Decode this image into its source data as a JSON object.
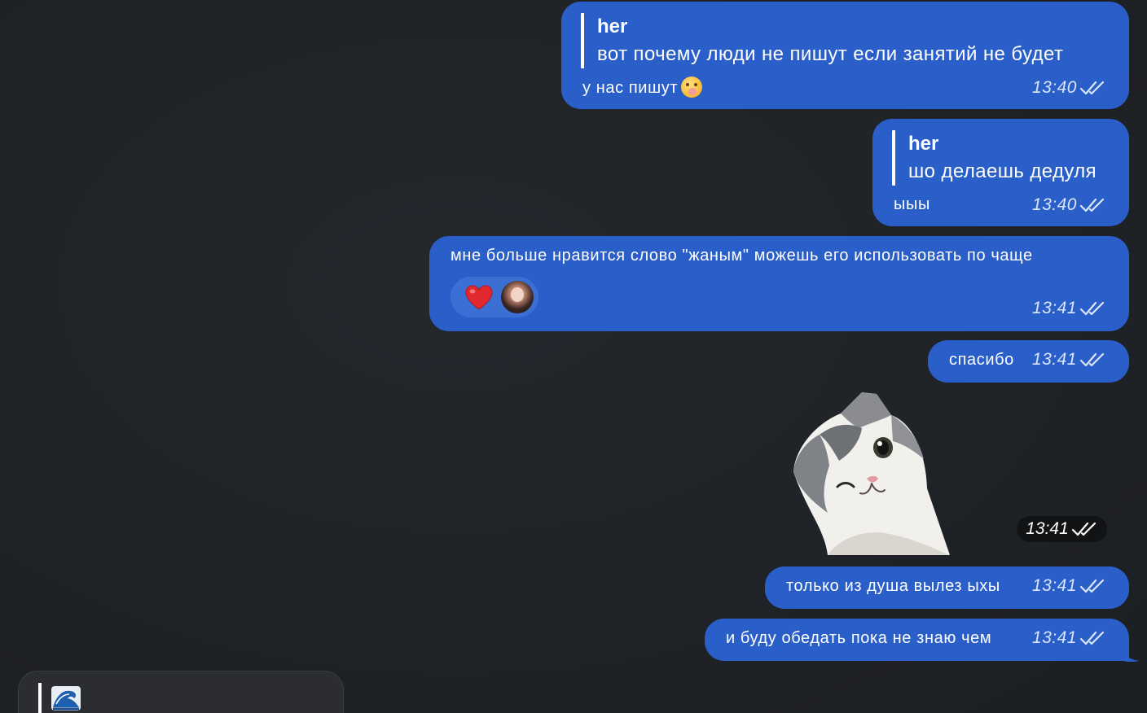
{
  "colors": {
    "background": "#202327",
    "outgoing_bubble": "#2a5fc9",
    "incoming_bubble": "#2b2d30",
    "reaction_pill": "#3b6fd4",
    "time_text": "#dce6fb"
  },
  "messages": [
    {
      "reply_author": "her",
      "reply_text": "вот почему люди не пишут если занятий не будет",
      "text": "у нас пишут",
      "emoji": "face-with-hand-over-mouth",
      "time": "13:40",
      "status": "read"
    },
    {
      "reply_author": "her",
      "reply_text": "шо делаешь дедуля",
      "text": "ыыы",
      "time": "13:40",
      "status": "read"
    },
    {
      "text": "мне больше нравится слово \"жаным\" можешь его использовать по чаще",
      "reaction": "red-heart",
      "reaction_user": "avatar",
      "time": "13:41",
      "status": "read"
    },
    {
      "text": "спасибо",
      "time": "13:41",
      "status": "read"
    },
    {
      "sticker": "winking-cat",
      "time": "13:41",
      "status": "read"
    },
    {
      "text": "только из душа вылез ыхы",
      "time": "13:41",
      "status": "read"
    },
    {
      "text": "и буду обедать пока не знаю чем",
      "time": "13:41",
      "status": "read"
    }
  ],
  "incoming_preview": {
    "emoji": "water-wave"
  }
}
